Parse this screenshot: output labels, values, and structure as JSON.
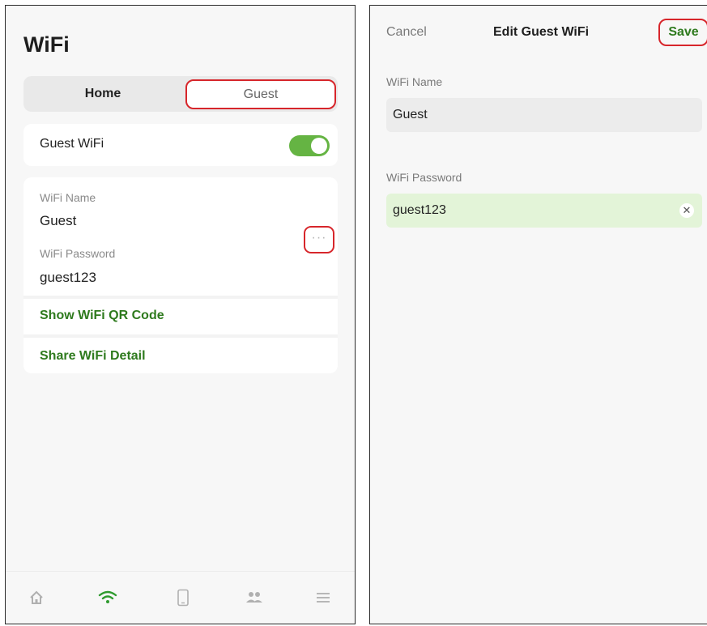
{
  "left": {
    "title": "WiFi",
    "segmented": {
      "home_label": "Home",
      "guest_label": "Guest"
    },
    "guest_toggle": {
      "label": "Guest WiFi",
      "on": true
    },
    "details": {
      "name_label": "WiFi Name",
      "name_value": "Guest",
      "password_label": "WiFi Password",
      "password_value": "guest123",
      "more_glyph": "···"
    },
    "links": {
      "qr": "Show WiFi QR Code",
      "share": "Share WiFi Detail"
    },
    "tabbar": {
      "items": [
        "home-icon",
        "wifi-icon",
        "device-icon",
        "people-icon",
        "menu-icon"
      ],
      "active": "wifi-icon"
    }
  },
  "right": {
    "cancel": "Cancel",
    "title": "Edit Guest WiFi",
    "save": "Save",
    "name_label": "WiFi Name",
    "name_value": "Guest",
    "password_label": "WiFi Password",
    "password_value": "guest123",
    "clear_glyph": "✕"
  },
  "colors": {
    "accent_green": "#2e7a1d",
    "toggle_green": "#65b443",
    "highlight_red": "#d7262b",
    "password_field_bg": "#e3f4d8"
  }
}
